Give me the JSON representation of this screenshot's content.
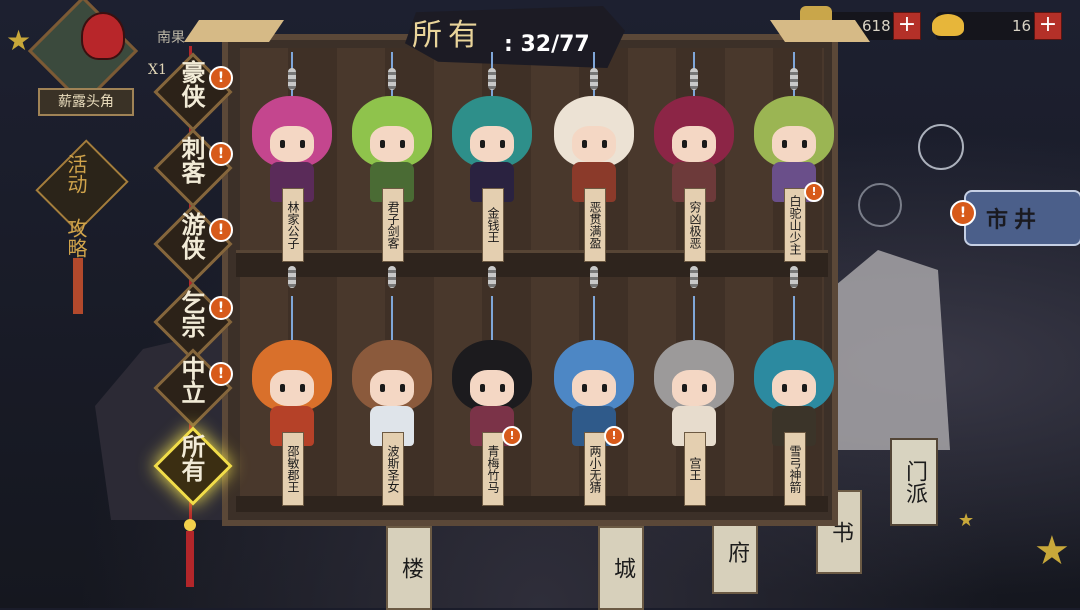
{
  "region": {
    "name": "南果",
    "label": "薪露头角",
    "x_mark": "X1"
  },
  "side": {
    "event": "活动",
    "guide": "攻略"
  },
  "currency": [
    {
      "icon": "scroll-coin-icon",
      "value": "618"
    },
    {
      "icon": "gold-ingot-icon",
      "value": "16"
    }
  ],
  "title": {
    "label": "所有",
    "count": ": 32/77"
  },
  "categories": [
    {
      "label": "豪侠",
      "alert": "!"
    },
    {
      "label": "刺客",
      "alert": "!"
    },
    {
      "label": "游侠",
      "alert": "!"
    },
    {
      "label": "乞宗",
      "alert": "!"
    },
    {
      "label": "中立",
      "alert": "!"
    },
    {
      "label": "所有",
      "alert": "",
      "active": true
    }
  ],
  "characters": [
    {
      "name": "林家公子",
      "alert": "",
      "hair": "#c4468e",
      "outfit": "#5a2b59"
    },
    {
      "name": "君子剑客",
      "alert": "",
      "hair": "#8fc34c",
      "outfit": "#4a6b34"
    },
    {
      "name": "金钱王",
      "alert": "",
      "hair": "#2e8f8a",
      "outfit": "#2a2240"
    },
    {
      "name": "恶贯满盈",
      "alert": "",
      "hair": "#ece2d4",
      "outfit": "#8b3a2a"
    },
    {
      "name": "穷凶极恶",
      "alert": "",
      "hair": "#8c2546",
      "outfit": "#6d3a3a"
    },
    {
      "name": "白驼山少主",
      "alert": "!",
      "hair": "#9bb553",
      "outfit": "#6a4f8a"
    },
    {
      "name": "邵敏郡王",
      "alert": "",
      "hair": "#d9702b",
      "outfit": "#b54128"
    },
    {
      "name": "波斯圣女",
      "alert": "",
      "hair": "#8b5a3c",
      "outfit": "#dfe4ea"
    },
    {
      "name": "青梅竹马",
      "alert": "!",
      "hair": "#1c1b1e",
      "outfit": "#7b3348"
    },
    {
      "name": "两小无猜",
      "alert": "!",
      "hair": "#4d87c5",
      "outfit": "#2f5a8a"
    },
    {
      "name": "宫王",
      "alert": "",
      "hair": "#9c9a9a",
      "outfit": "#e7dccd"
    },
    {
      "name": "雪弓神箭",
      "alert": "",
      "hair": "#2c8aa0",
      "outfit": "#3b3429"
    }
  ],
  "market": {
    "label": "市井",
    "alert": "!"
  },
  "sect": {
    "label": "门派"
  },
  "background_signs": [
    "门派",
    "城",
    "府",
    "书",
    "楼"
  ]
}
